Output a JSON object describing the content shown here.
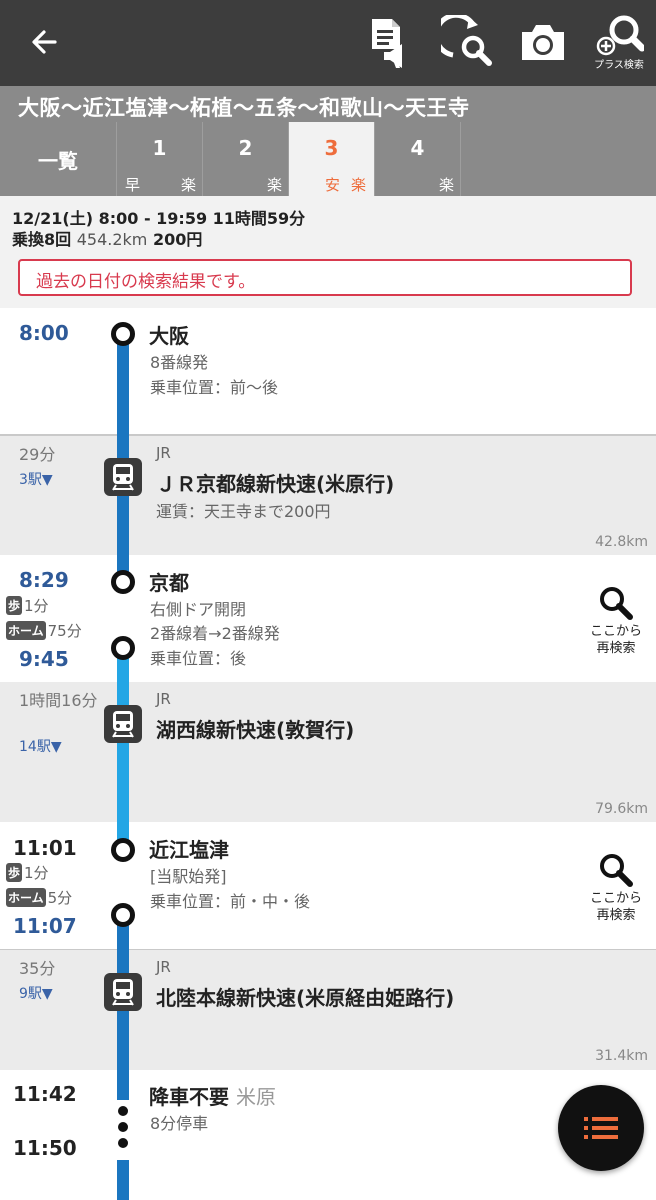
{
  "appbar": {
    "icons": [
      "back-arrow-icon",
      "memo-share-icon",
      "search-refresh-icon",
      "camera-icon",
      "plus-search-icon"
    ],
    "plus_search_label": "プラス検索"
  },
  "route": {
    "title": "大阪〜近江塩津〜柘植〜五条〜和歌山〜天王寺",
    "list_tab": "一覧",
    "tabs": [
      {
        "num": "1",
        "tags": [
          "早",
          "楽"
        ],
        "active": false
      },
      {
        "num": "2",
        "tags": [
          "楽"
        ],
        "active": false
      },
      {
        "num": "3",
        "tags": [
          "安",
          "楽"
        ],
        "active": true
      },
      {
        "num": "4",
        "tags": [
          "楽"
        ],
        "active": false
      }
    ]
  },
  "summary": {
    "line1": "12/21(土) 8:00 - 19:59 11時間59分",
    "transfers": "乗換8回",
    "distance": "454.2km",
    "fare": "200円",
    "warning": "過去の日付の検索結果です。"
  },
  "stops": [
    {
      "arr": "8:00",
      "name": "大阪",
      "sub1": "8番線発",
      "sub2": "乗車位置：前〜後"
    },
    {
      "arr": "8:29",
      "dep": "9:45",
      "walk": "1分",
      "home": "75分",
      "name": "京都",
      "sub1": "右側ドア開閉",
      "sub2": "2番線着→2番線発",
      "sub3": "乗車位置：後"
    },
    {
      "arr": "11:01",
      "dep": "11:07",
      "walk": "1分",
      "home": "5分",
      "name": "近江塩津",
      "sub1": "[当駅始発]",
      "sub2": "乗車位置：前・中・後"
    },
    {
      "arr": "11:42",
      "dep": "11:50",
      "name": "降車不要",
      "name_extra": "米原",
      "sub1": "8分停車"
    }
  ],
  "rides": [
    {
      "duration": "29分",
      "stations": "3駅▼",
      "company": "JR",
      "name": "ＪＲ京都線新快速(米原行)",
      "fare": "運賃：天王寺まで200円",
      "km": "42.8km"
    },
    {
      "duration": "1時間16分",
      "stations": "14駅▼",
      "company": "JR",
      "name": "湖西線新快速(敦賀行)",
      "km": "79.6km"
    },
    {
      "duration": "35分",
      "stations": "9駅▼",
      "company": "JR",
      "name": "北陸本線新快速(米原経由姫路行)",
      "km": "31.4km"
    }
  ],
  "labels": {
    "walk_badge": "歩",
    "home_badge": "ホーム",
    "research": "ここから",
    "research2": "再検索"
  },
  "colors": {
    "appbar": "#3d3d3d",
    "route_header": "#8a8a8a",
    "accent_orange": "#ee6d3c",
    "time_blue": "#2f5a98",
    "line_dark_blue": "#1b76c0",
    "line_light_blue": "#23a6e5",
    "warning_red": "#d83a4e"
  }
}
